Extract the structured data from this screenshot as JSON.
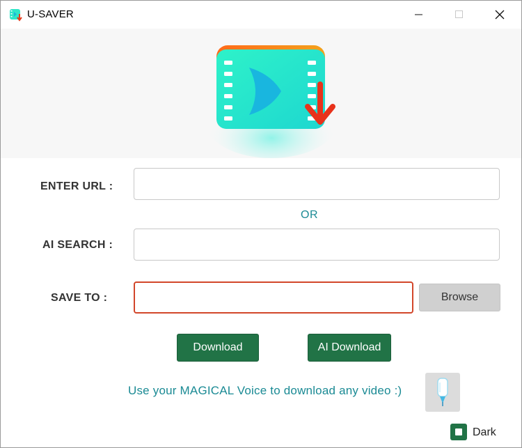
{
  "window": {
    "title": "U-SAVER"
  },
  "form": {
    "url_label": "ENTER URL :",
    "url_value": "",
    "or_text": "OR",
    "ai_search_label": "AI SEARCH :",
    "ai_search_value": "",
    "save_to_label": "SAVE TO :",
    "save_to_value": "",
    "browse_label": "Browse"
  },
  "actions": {
    "download_label": "Download",
    "ai_download_label": "AI Download"
  },
  "voice": {
    "prompt": "Use your MAGICAL Voice to download any video :)",
    "icon": "microphone-icon"
  },
  "theme": {
    "dark_label": "Dark",
    "accent": "#217346",
    "teal_text": "#1a8a94",
    "error_border": "#d2462a"
  }
}
